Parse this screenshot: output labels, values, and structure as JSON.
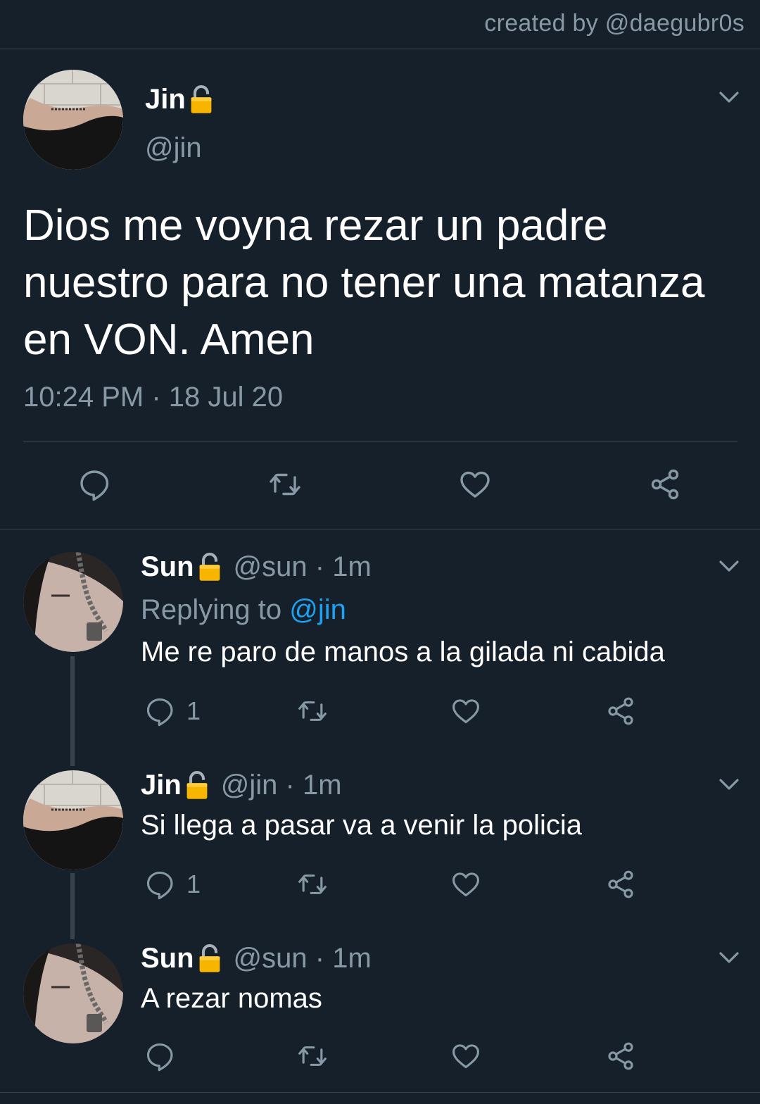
{
  "header": {
    "credit": "created by @daegubr0s"
  },
  "main_tweet": {
    "name": "Jin",
    "lock_icon": "lock-icon",
    "handle": "@jin",
    "text": "Dios me voyna rezar un padre nuestro para no tener una matanza en VON. Amen",
    "timestamp": "10:24 PM · 18 Jul 20"
  },
  "replies": [
    {
      "name": "Sun",
      "meta": "@sun · 1m",
      "replying_prefix": "Replying to",
      "replying_mention": "@jin",
      "text": "Me re paro de manos a la gilada ni cabida",
      "reply_count": "1"
    },
    {
      "name": "Jin",
      "meta": "@jin · 1m",
      "text": "Si llega a pasar va a venir la policia",
      "reply_count": "1"
    },
    {
      "name": "Sun",
      "meta": "@sun · 1m",
      "text": "A rezar nomas",
      "reply_count": ""
    }
  ],
  "colors": {
    "background": "#15202b",
    "muted": "#8899a6",
    "accent": "#1da1f2",
    "divider": "#38444d"
  }
}
